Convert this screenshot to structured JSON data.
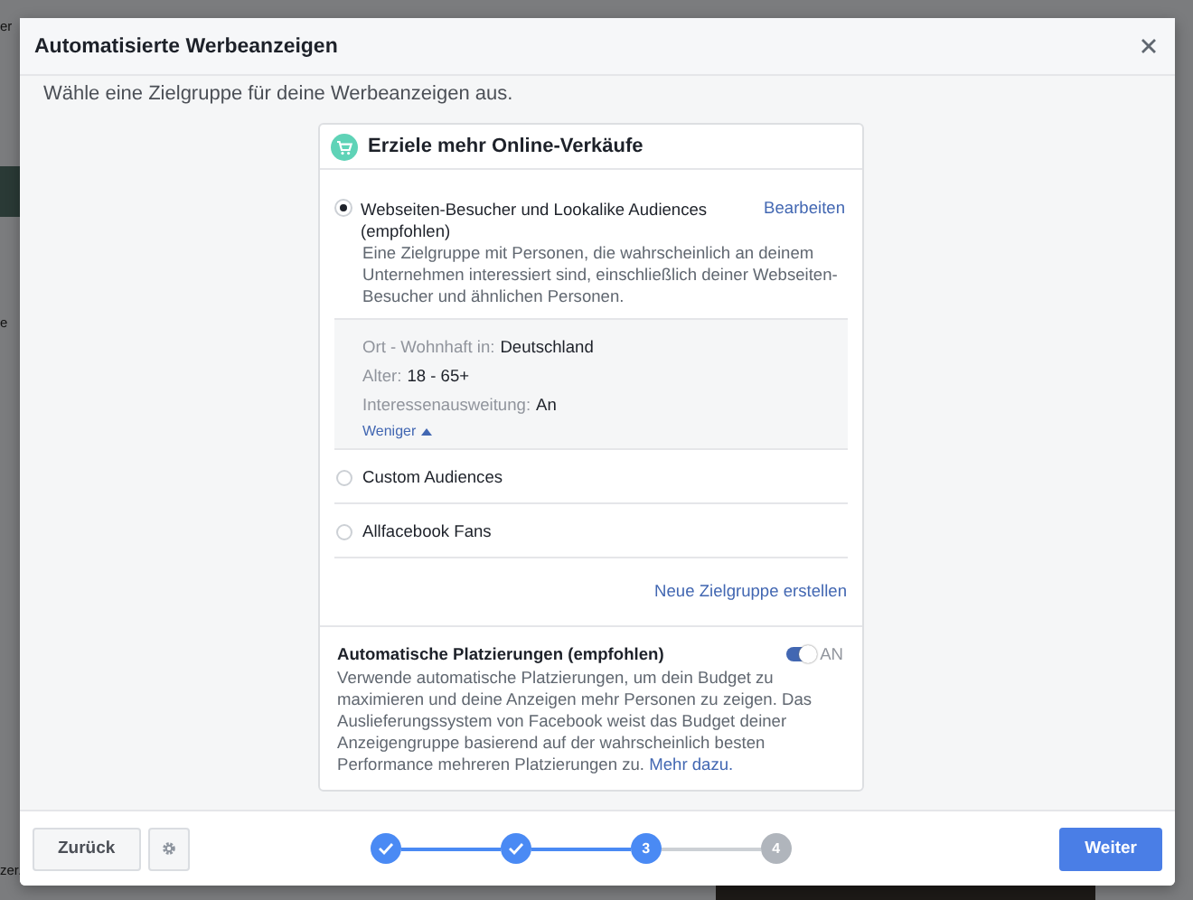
{
  "background": {
    "fragments": [
      {
        "text": "er"
      },
      {
        "text": "e"
      },
      {
        "text": "zer."
      }
    ]
  },
  "dialog": {
    "title": "Automatisierte Werbeanzeigen",
    "subtitle": "Wähle eine Zielgruppe für deine Werbeanzeigen aus."
  },
  "goal_card": {
    "title": "Erziele mehr Online-Verkäufe",
    "audiences": [
      {
        "kind": "detailed",
        "selected": true,
        "title": "Webseiten-Besucher und Lookalike Audiences (empfohlen)",
        "edit_link": "Bearbeiten",
        "description": "Eine Zielgruppe mit Personen, die wahrscheinlich an deinem Unternehmen interessiert sind, einschließlich deiner Webseiten-Besucher und ähnlichen Personen.",
        "details": [
          {
            "label": "Ort - Wohnhaft in:",
            "value": "Deutschland"
          },
          {
            "label": "Alter:",
            "value": "18 - 65+"
          },
          {
            "label": "Interessenausweitung:",
            "value": "An"
          }
        ],
        "less_link": "Weniger"
      },
      {
        "kind": "simple",
        "selected": false,
        "title": "Custom Audiences"
      },
      {
        "kind": "simple",
        "selected": false,
        "title": "Allfacebook Fans"
      }
    ],
    "create_link": "Neue Zielgruppe erstellen",
    "placements": {
      "title": "Automatische Platzierungen (empfohlen)",
      "on": true,
      "toggle_label": "AN",
      "description": "Verwende automatische Platzierungen, um dein Budget zu maximieren und deine Anzeigen mehr Personen zu zeigen. Das Auslieferungssystem von Facebook weist das Budget deiner Anzeigengruppe basierend auf der wahrscheinlich besten Performance mehreren Platzierungen zu.",
      "more_link": "Mehr dazu."
    }
  },
  "footer": {
    "back_button": "Zurück",
    "steps": [
      {
        "done": true,
        "current": false
      },
      {
        "done": true,
        "current": false
      },
      {
        "done": false,
        "current": true,
        "label": "3"
      },
      {
        "done": false,
        "current": false,
        "label": "4"
      }
    ],
    "next_button": "Weiter"
  }
}
